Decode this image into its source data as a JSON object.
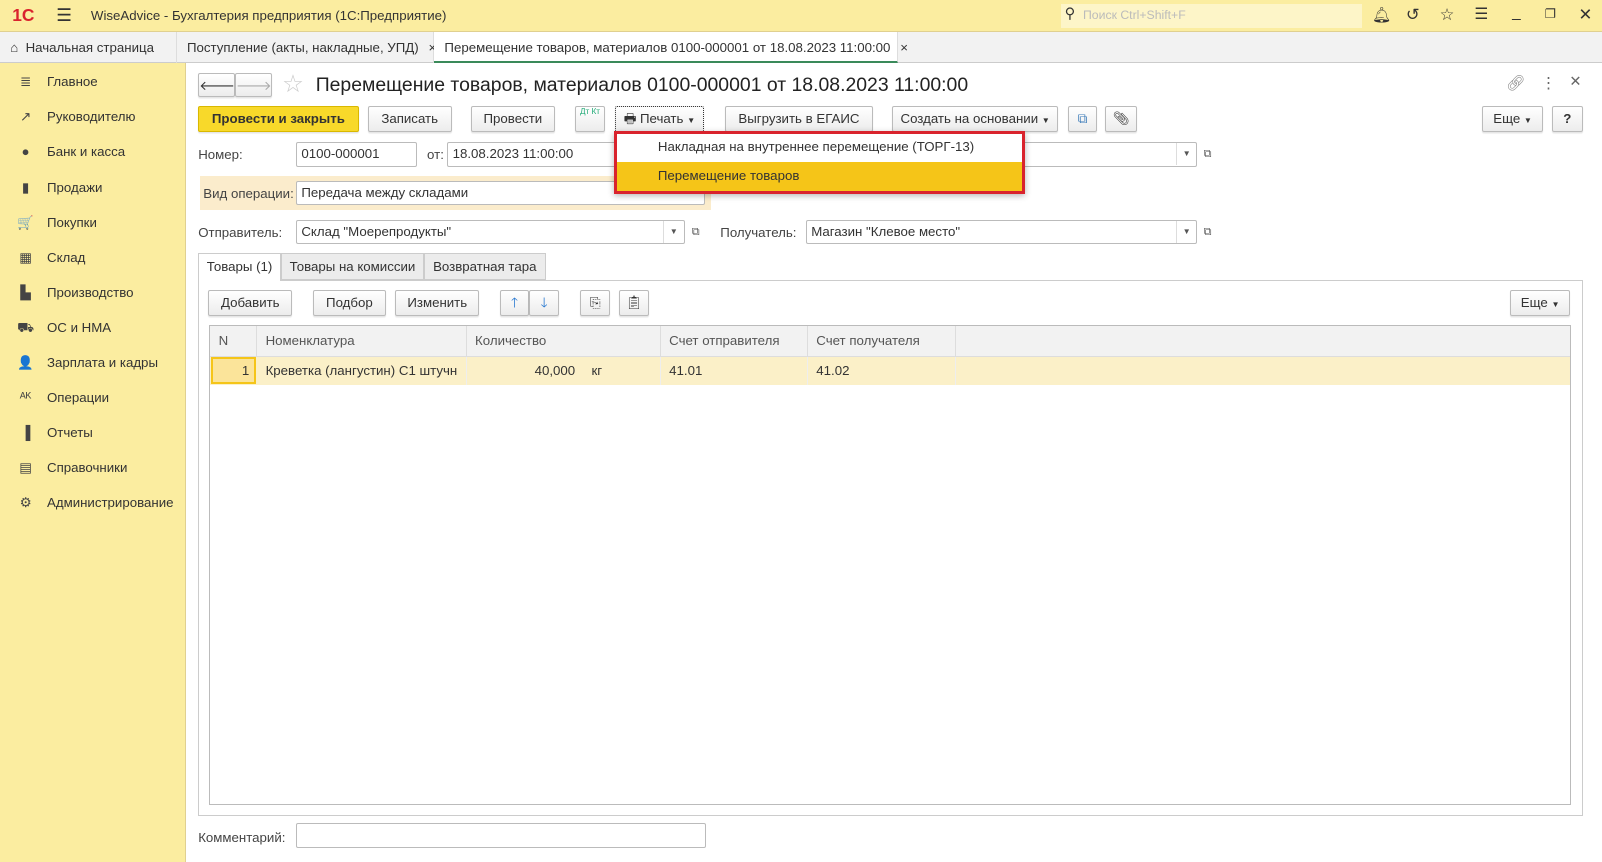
{
  "titlebar": {
    "logo": "1С",
    "title": "WiseAdvice - Бухгалтерия предприятия  (1С:Предприятие)",
    "search_placeholder": "Поиск Ctrl+Shift+F"
  },
  "tabs": [
    {
      "label": "Начальная страница"
    },
    {
      "label": "Поступление (акты, накладные, УПД)",
      "close": "×"
    },
    {
      "label": "Перемещение товаров, материалов 0100-000001 от 18.08.2023 11:00:00",
      "close": "×"
    }
  ],
  "sidebar": {
    "items": [
      {
        "label": "Главное",
        "icon": "≣"
      },
      {
        "label": "Руководителю",
        "icon": "↗"
      },
      {
        "label": "Банк и касса",
        "icon": "●"
      },
      {
        "label": "Продажи",
        "icon": "▮"
      },
      {
        "label": "Покупки",
        "icon": "🛒"
      },
      {
        "label": "Склад",
        "icon": "▦"
      },
      {
        "label": "Производство",
        "icon": "▙"
      },
      {
        "label": "ОС и НМА",
        "icon": "⛟"
      },
      {
        "label": "Зарплата и кадры",
        "icon": "👤"
      },
      {
        "label": "Операции",
        "icon": "ᴬᴷ"
      },
      {
        "label": "Отчеты",
        "icon": "▐"
      },
      {
        "label": "Справочники",
        "icon": "▤"
      },
      {
        "label": "Администрирование",
        "icon": "⚙"
      }
    ]
  },
  "document": {
    "title": "Перемещение товаров, материалов 0100-000001 от 18.08.2023 11:00:00",
    "toolbar": {
      "post_close": "Провести и закрыть",
      "save": "Записать",
      "post": "Провести",
      "dtkt": "Дт Кт",
      "print": "Печать",
      "egais": "Выгрузить в ЕГАИС",
      "create_based": "Создать на основании",
      "more": "Еще",
      "help": "?"
    },
    "print_menu": {
      "items": [
        "Накладная на внутреннее перемещение (ТОРГ-13)",
        "Перемещение товаров"
      ],
      "selected": 1
    },
    "fields": {
      "number_label": "Номер:",
      "number": "0100-000001",
      "date_label": "от:",
      "date": "18.08.2023 11:00:00",
      "operation_label": "Вид операции:",
      "operation": "Передача между складами",
      "sender_label": "Отправитель:",
      "sender": "Склад \"Моерепродукты\"",
      "receiver_label": "Получатель:",
      "receiver": "Магазин \"Клевое место\"",
      "comment_label": "Комментарий:",
      "comment": ""
    },
    "subtabs": [
      "Товары (1)",
      "Товары на комиссии",
      "Возвратная тара"
    ],
    "table_toolbar": {
      "add": "Добавить",
      "pick": "Подбор",
      "edit": "Изменить",
      "more": "Еще"
    },
    "table": {
      "columns": [
        "N",
        "Номенклатура",
        "Количество",
        "Счет отправителя",
        "Счет получателя"
      ],
      "rows": [
        {
          "n": "1",
          "item": "Креветка (лангустин) С1 штучн",
          "qty": "40,000",
          "unit": "кг",
          "from": "41.01",
          "to": "41.02"
        }
      ]
    }
  },
  "colors": {
    "accent": "#f8d92a",
    "sidebar": "#fbeda0",
    "menu_border": "#d9232d",
    "menu_selected": "#f5c518"
  }
}
